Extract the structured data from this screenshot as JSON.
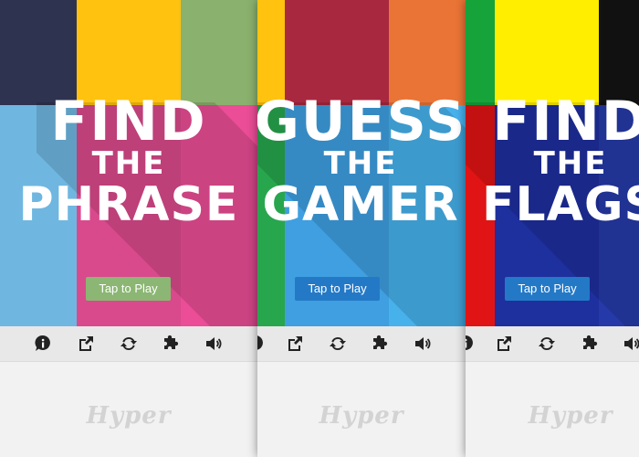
{
  "panels": [
    {
      "id": "phrase",
      "title_line1": "FIND",
      "title_line2": "THE",
      "title_line3": "PHRASE",
      "play_label": "Tap to Play",
      "play_color": "#8bb673",
      "colors": [
        "#2e3350",
        "#ffc20e",
        "#8bb16e",
        "#6fb7e0",
        "#d94a8c",
        "#eb4d96"
      ],
      "brand": "Hyper"
    },
    {
      "id": "gamer",
      "title_line1": "GUESS",
      "title_line2": "THE",
      "title_line3": "GAMER",
      "play_label": "Tap to Play",
      "play_color": "#2479c7",
      "colors": [
        "#ffc20e",
        "#a8283f",
        "#ea7436",
        "#28a64e",
        "#3f9fe0",
        "#47b1ec"
      ],
      "brand": "Hyper"
    },
    {
      "id": "flags",
      "title_line1": "FIND",
      "title_line2": "THE",
      "title_line3": "FLAGS",
      "play_label": "Tap to Play",
      "play_color": "#2479c7",
      "colors": [
        "#16a33a",
        "#ffee00",
        "#111111",
        "#e01414",
        "#1e2f9e",
        "#253aa8"
      ],
      "brand": "Hyper"
    }
  ],
  "toolbar_icons": [
    "info-icon",
    "share-icon",
    "refresh-icon",
    "puzzle-icon",
    "volume-icon"
  ]
}
